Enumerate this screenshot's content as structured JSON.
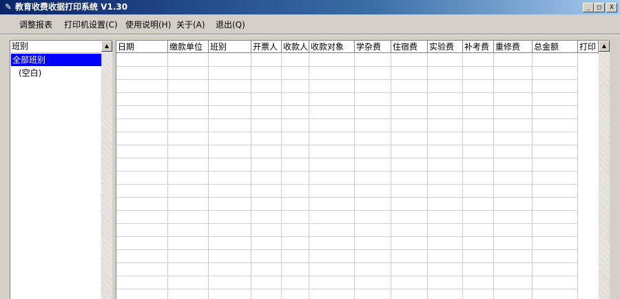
{
  "window": {
    "title": "教育收费收据打印系统 V1.30",
    "icon": "app-icon",
    "buttons": {
      "minimize": "_",
      "maximize": "□",
      "close": "X"
    }
  },
  "menu": [
    {
      "label": "调整报表"
    },
    {
      "label": "打印机设置(C)"
    },
    {
      "label": "使用说明(H)"
    },
    {
      "label": "关于(A)"
    },
    {
      "label": "退出(Q)"
    }
  ],
  "class_panel": {
    "header": "班别",
    "items": [
      {
        "label": "全部班别",
        "selected": true
      },
      {
        "label": "(空白)",
        "selected": false
      }
    ]
  },
  "grid": {
    "columns": [
      "日期",
      "缴款单位",
      "班别",
      "开票人",
      "收款人",
      "收款对象",
      "学杂费",
      "住宿费",
      "实验费",
      "补考费",
      "重修费",
      "总金额",
      "打印"
    ],
    "rows": []
  },
  "colors": {
    "title_start": "#0a246a",
    "title_end": "#a6caf0",
    "selection": "#0000ff",
    "face": "#d4d0c8"
  }
}
